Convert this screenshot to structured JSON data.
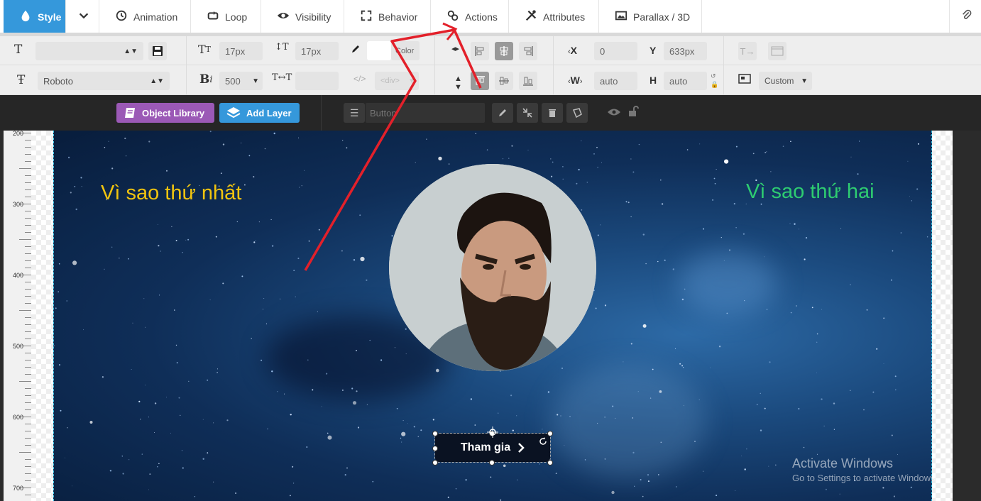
{
  "tabs": [
    {
      "label": "Style",
      "icon": "droplet-icon",
      "active": true
    },
    {
      "label": "Animation",
      "icon": "history-icon"
    },
    {
      "label": "Loop",
      "icon": "loop-icon"
    },
    {
      "label": "Visibility",
      "icon": "eye-icon"
    },
    {
      "label": "Behavior",
      "icon": "expand-icon"
    },
    {
      "label": "Actions",
      "icon": "link-icon"
    },
    {
      "label": "Attributes",
      "icon": "tools-icon"
    },
    {
      "label": "Parallax / 3D",
      "icon": "image-icon"
    }
  ],
  "toolbar": {
    "font_size": "17px",
    "line_height": "17px",
    "color_label": "Color",
    "font_family": "Roboto",
    "font_weight": "500",
    "tag_placeholder": "</>",
    "tag_value": "<div>",
    "x_label": "X",
    "x_value": "0",
    "y_label": "Y",
    "y_value": "633px",
    "w_label": "W",
    "w_value": "auto",
    "h_label": "H",
    "h_value": "auto",
    "cover_mode": "Custom"
  },
  "layerbar": {
    "object_library": "Object Library",
    "add_layer": "Add Layer",
    "layer_name": "Button"
  },
  "ruler_labels": [
    "200",
    "300",
    "400",
    "500",
    "600",
    "700"
  ],
  "canvas": {
    "title_left": "Vì sao thứ nhất",
    "title_right": "Vì sao thứ hai",
    "button_label": "Tham gia"
  },
  "watermark": {
    "line1": "Activate Windows",
    "line2": "Go to Settings to activate Windows."
  },
  "colors": {
    "accent": "#3598db",
    "purple": "#9b59b6",
    "title_left": "#f1c40f",
    "title_right": "#2ecc71",
    "annotation": "#e3202a"
  }
}
